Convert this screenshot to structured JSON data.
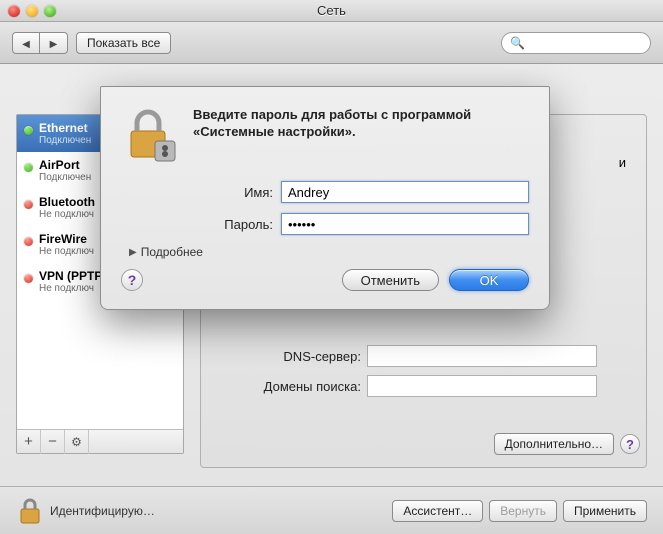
{
  "window": {
    "title": "Сеть"
  },
  "toolbar": {
    "back": "◀",
    "forward": "▶",
    "show_all": "Показать все",
    "search_placeholder": ""
  },
  "sidebar": {
    "items": [
      {
        "title": "Ethernet",
        "sub": "Подключен",
        "status": "green",
        "selected": true
      },
      {
        "title": "AirPort",
        "sub": "Подключен",
        "status": "green",
        "selected": false
      },
      {
        "title": "Bluetooth",
        "sub": "Не подключ",
        "status": "red",
        "selected": false
      },
      {
        "title": "FireWire",
        "sub": "Не подключ",
        "status": "red",
        "selected": false
      },
      {
        "title": "VPN (PPTP",
        "sub": "Не подключ",
        "status": "red",
        "selected": false
      }
    ]
  },
  "right_panel": {
    "status_fragment": "и",
    "dns_label": "DNS-сервер:",
    "dns_value": "",
    "search_domains_label": "Домены поиска:",
    "search_domains_value": "",
    "advanced_label": "Дополнительно…"
  },
  "footer": {
    "lock_text": "Идентифицирую…",
    "assistant": "Ассистент…",
    "revert": "Вернуть",
    "apply": "Применить"
  },
  "dialog": {
    "message": "Введите пароль для работы с программой «Системные настройки».",
    "name_label": "Имя:",
    "name_value": "Andrey",
    "password_label": "Пароль:",
    "password_value": "••••••",
    "details": "Подробнее",
    "cancel": "Отменить",
    "ok": "OK"
  }
}
